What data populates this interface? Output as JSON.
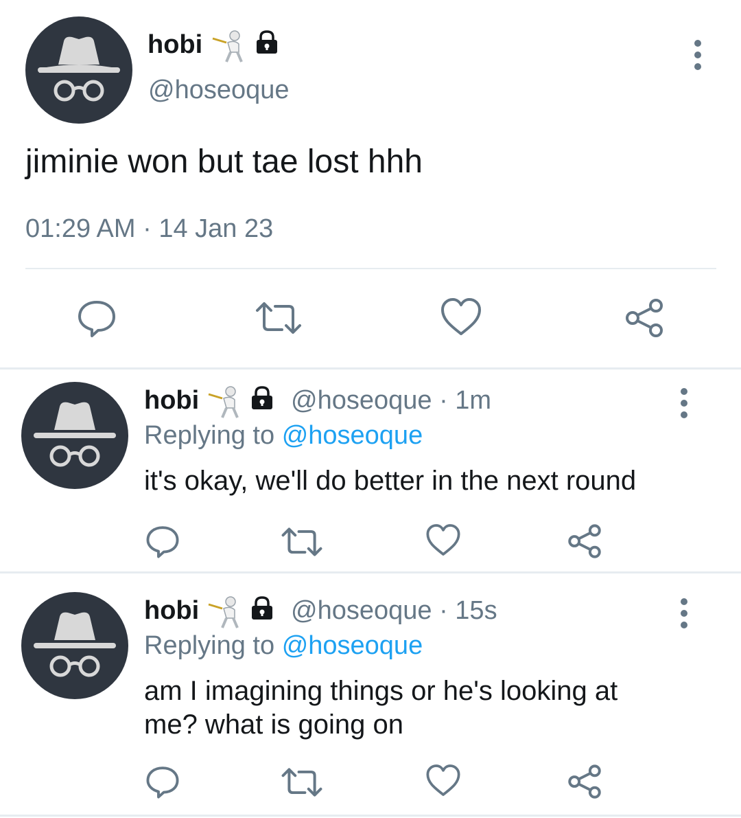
{
  "main_tweet": {
    "display_name": "hobi",
    "handle": "@hoseoque",
    "text": "jiminie won but tae lost hhh",
    "time": "01:29 AM",
    "date": "14 Jan 23",
    "separator": "·"
  },
  "replies": [
    {
      "display_name": "hobi",
      "handle": "@hoseoque",
      "age": "1m",
      "separator": "·",
      "replying_prefix": "Replying to",
      "replying_to": "@hoseoque",
      "text": "it's okay, we'll do better in the next round"
    },
    {
      "display_name": "hobi",
      "handle": "@hoseoque",
      "age": "15s",
      "separator": "·",
      "replying_prefix": "Replying to",
      "replying_to": "@hoseoque",
      "text_line1": "am I imagining things or he's looking at",
      "text_line2": "me? what is going on"
    }
  ],
  "icons": {
    "avatar": "incognito-avatar",
    "badge_emoji": "fencer-emoji",
    "lock": "lock-icon",
    "more": "more-vertical-icon",
    "reply": "reply-icon",
    "retweet": "retweet-icon",
    "like": "heart-icon",
    "share": "share-icon"
  },
  "colors": {
    "text": "#14171a",
    "muted": "#657786",
    "link": "#1da1f2",
    "avatar_bg": "#2f3640",
    "divider": "#e6ecf0"
  }
}
